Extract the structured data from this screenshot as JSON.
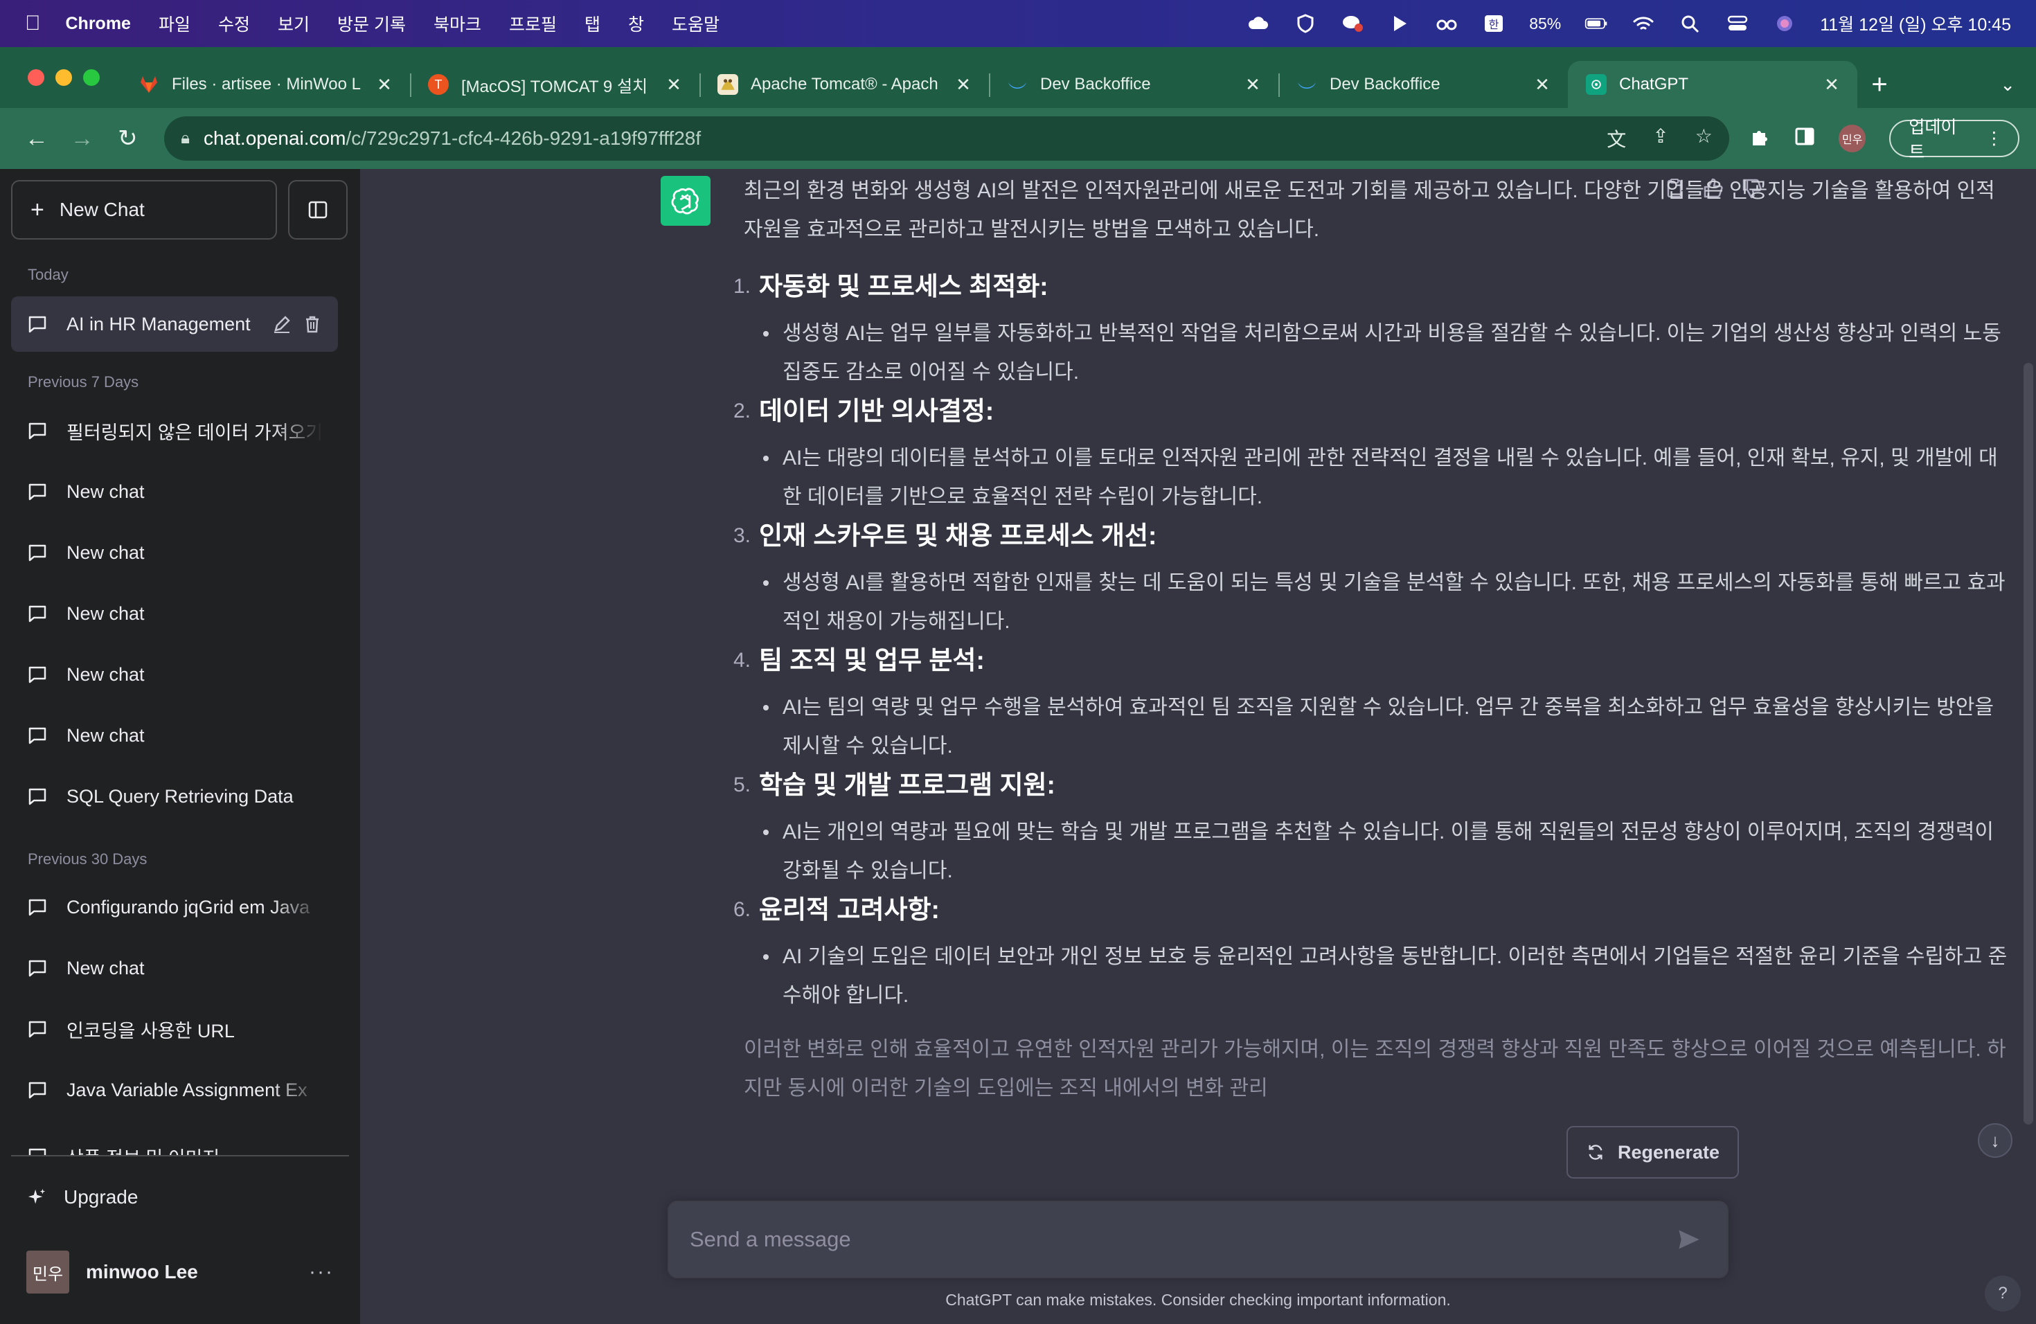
{
  "menubar": {
    "app": "Chrome",
    "menus": [
      "파일",
      "수정",
      "보기",
      "방문 기록",
      "북마크",
      "프로필",
      "탭",
      "창",
      "도움말"
    ],
    "battery": "85%",
    "datetime": "11월 12일 (일) 오후 10:45"
  },
  "tabs": [
    {
      "title": "Files · artisee · MinWoo L",
      "favicon": "gitlab-icon",
      "color": "#e24329"
    },
    {
      "title": "[MacOS] TOMCAT 9 설치",
      "favicon": "tistory-icon",
      "color": "#eb531f"
    },
    {
      "title": "Apache Tomcat® - Apach",
      "favicon": "tomcat-icon",
      "color": "#d8b33a"
    },
    {
      "title": "Dev Backoffice",
      "favicon": "backoffice-icon",
      "color": "#3fa7ff"
    },
    {
      "title": "Dev Backoffice",
      "favicon": "backoffice-icon",
      "color": "#3fa7ff"
    },
    {
      "title": "ChatGPT",
      "favicon": "chatgpt-icon",
      "color": "#10a37f"
    }
  ],
  "toolbar": {
    "url_host": "chat.openai.com",
    "url_path": "/c/729c2971-cfc4-426b-9291-a19f97fff28f",
    "profile_initials": "민우",
    "update_label": "업데이트"
  },
  "sidebar": {
    "new_chat": "New Chat",
    "sections": {
      "today": "Today",
      "prev7": "Previous 7 Days",
      "prev30": "Previous 30 Days"
    },
    "items": [
      {
        "label": "AI in HR Management"
      },
      {
        "label": "필터링되지 않은 데이터 가져오기"
      },
      {
        "label": "New chat"
      },
      {
        "label": "New chat"
      },
      {
        "label": "New chat"
      },
      {
        "label": "New chat"
      },
      {
        "label": "New chat"
      },
      {
        "label": "SQL Query Retrieving Data"
      },
      {
        "label": "Configurando jqGrid em Java"
      },
      {
        "label": "New chat"
      },
      {
        "label": "인코딩을 사용한 URL"
      },
      {
        "label": "Java Variable Assignment Ex"
      },
      {
        "label": "상품 정보 및 이미지"
      }
    ],
    "upgrade": "Upgrade",
    "user_initials": "민우",
    "user_name": "minwoo Lee"
  },
  "chat": {
    "intro": "최근의 환경 변화와 생성형 AI의 발전은 인적자원관리에 새로운 도전과 기회를 제공하고 있습니다. 다양한 기업들은 인공지능 기술을 활용하여 인적자원을 효과적으로 관리하고 발전시키는 방법을 모색하고 있습니다.",
    "points": [
      {
        "num": "1.",
        "title": "자동화 및 프로세스 최적화:",
        "body": "생성형 AI는 업무 일부를 자동화하고 반복적인 작업을 처리함으로써 시간과 비용을 절감할 수 있습니다. 이는 기업의 생산성 향상과 인력의 노동 집중도 감소로 이어질 수 있습니다."
      },
      {
        "num": "2.",
        "title": "데이터 기반 의사결정:",
        "body": "AI는 대량의 데이터를 분석하고 이를 토대로 인적자원 관리에 관한 전략적인 결정을 내릴 수 있습니다. 예를 들어, 인재 확보, 유지, 및 개발에 대한 데이터를 기반으로 효율적인 전략 수립이 가능합니다."
      },
      {
        "num": "3.",
        "title": "인재 스카우트 및 채용 프로세스 개선:",
        "body": "생성형 AI를 활용하면 적합한 인재를 찾는 데 도움이 되는 특성 및 기술을 분석할 수 있습니다. 또한, 채용 프로세스의 자동화를 통해 빠르고 효과적인 채용이 가능해집니다."
      },
      {
        "num": "4.",
        "title": "팀 조직 및 업무 분석:",
        "body": "AI는 팀의 역량 및 업무 수행을 분석하여 효과적인 팀 조직을 지원할 수 있습니다. 업무 간 중복을 최소화하고 업무 효율성을 향상시키는 방안을 제시할 수 있습니다."
      },
      {
        "num": "5.",
        "title": "학습 및 개발 프로그램 지원:",
        "body": "AI는 개인의 역량과 필요에 맞는 학습 및 개발 프로그램을 추천할 수 있습니다. 이를 통해 직원들의 전문성 향상이 이루어지며, 조직의 경쟁력이 강화될 수 있습니다."
      },
      {
        "num": "6.",
        "title": "윤리적 고려사항:",
        "body": "AI 기술의 도입은 데이터 보안과 개인 정보 보호 등 윤리적인 고려사항을 동반합니다. 이러한 측면에서 기업들은 적절한 윤리 기준을 수립하고 준수해야 합니다."
      }
    ],
    "conclusion": "이러한 변화로 인해 효율적이고 유연한 인적자원 관리가 가능해지며, 이는 조직의 경쟁력 향상과 직원 만족도 향상으로 이어질 것으로 예측됩니다. 하지만 동시에 이러한 기술의 도입에는 조직 내에서의 변화 관리",
    "regenerate": "Regenerate",
    "input_placeholder": "Send a message",
    "disclaimer": "ChatGPT can make mistakes. Consider checking important information.",
    "help": "?"
  },
  "colors": {
    "accent": "#19c37d",
    "chrome_green": "#2d6f55"
  }
}
